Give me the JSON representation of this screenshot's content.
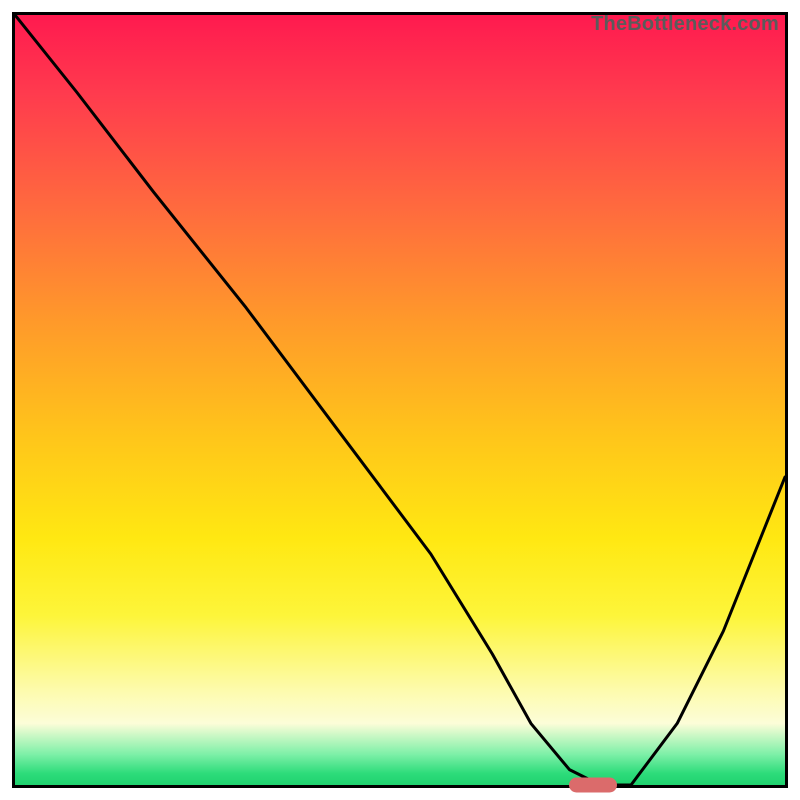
{
  "watermark": "TheBottleneck.com",
  "colors": {
    "gradient_top": "#ff1a4f",
    "gradient_mid": "#ffe812",
    "gradient_bottom": "#1fd26f",
    "curve_stroke": "#000000",
    "marker_fill": "#db6b6b",
    "frame_border": "#000000",
    "watermark_color": "#5b5b5b"
  },
  "chart_data": {
    "type": "line",
    "title": "",
    "xlabel": "",
    "ylabel": "",
    "xlim": [
      0,
      100
    ],
    "ylim": [
      0,
      100
    ],
    "grid": false,
    "legend": false,
    "series": [
      {
        "name": "bottleneck-curve",
        "x": [
          0,
          8,
          18,
          30,
          42,
          54,
          62,
          67,
          72,
          76,
          80,
          86,
          92,
          100
        ],
        "values": [
          100,
          90,
          77,
          62,
          46,
          30,
          17,
          8,
          2,
          0,
          0,
          8,
          20,
          40
        ]
      }
    ],
    "annotations": [
      {
        "name": "optimal-marker",
        "x": 75,
        "y": 0
      }
    ],
    "note": "Values are read off the figure to plotted precision; minimum (optimal point) lies near x≈73–78."
  }
}
